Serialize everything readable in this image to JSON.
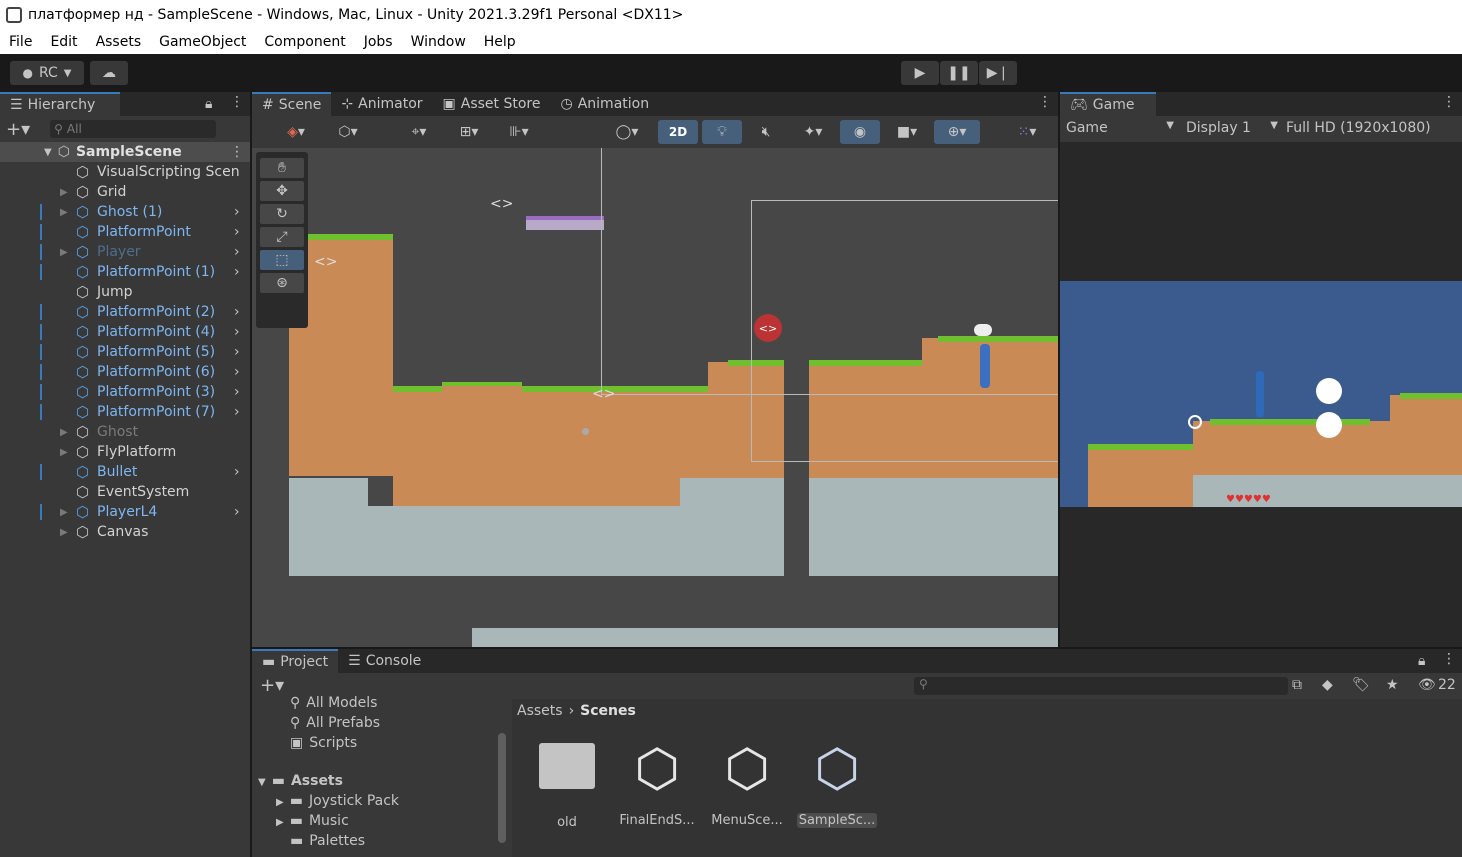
{
  "window": {
    "title": "платформер нд - SampleScene - Windows, Mac, Linux - Unity 2021.3.29f1 Personal <DX11>"
  },
  "menu": [
    "File",
    "Edit",
    "Assets",
    "GameObject",
    "Component",
    "Jobs",
    "Window",
    "Help"
  ],
  "toolbar": {
    "account": "RC"
  },
  "hierarchy": {
    "tab": "Hierarchy",
    "search_placeholder": "All",
    "scene": "SampleScene",
    "items": [
      {
        "label": "VisualScripting Scen",
        "style": "normal",
        "arrow": false,
        "chev": false
      },
      {
        "label": "Grid",
        "style": "normal",
        "arrow": true,
        "chev": false
      },
      {
        "label": "Ghost (1)",
        "style": "blue",
        "arrow": true,
        "chev": true
      },
      {
        "label": "PlatformPoint",
        "style": "blue",
        "arrow": false,
        "chev": true
      },
      {
        "label": "Player",
        "style": "bluedim",
        "arrow": true,
        "chev": true
      },
      {
        "label": "PlatformPoint (1)",
        "style": "blue",
        "arrow": false,
        "chev": true
      },
      {
        "label": "Jump",
        "style": "normal",
        "arrow": false,
        "chev": false
      },
      {
        "label": "PlatformPoint (2)",
        "style": "blue",
        "arrow": false,
        "chev": true
      },
      {
        "label": "PlatformPoint (4)",
        "style": "blue",
        "arrow": false,
        "chev": true
      },
      {
        "label": "PlatformPoint (5)",
        "style": "blue",
        "arrow": false,
        "chev": true
      },
      {
        "label": "PlatformPoint (6)",
        "style": "blue",
        "arrow": false,
        "chev": true
      },
      {
        "label": "PlatformPoint (3)",
        "style": "blue",
        "arrow": false,
        "chev": true
      },
      {
        "label": "PlatformPoint (7)",
        "style": "blue",
        "arrow": false,
        "chev": true
      },
      {
        "label": "Ghost",
        "style": "dim",
        "arrow": true,
        "chev": false
      },
      {
        "label": "FlyPlatform",
        "style": "normal",
        "arrow": true,
        "chev": false
      },
      {
        "label": "Bullet",
        "style": "blue",
        "arrow": false,
        "chev": true
      },
      {
        "label": "EventSystem",
        "style": "normal",
        "arrow": false,
        "chev": false
      },
      {
        "label": "PlayerL4",
        "style": "blue",
        "arrow": true,
        "chev": true
      },
      {
        "label": "Canvas",
        "style": "normal",
        "arrow": true,
        "chev": false
      }
    ]
  },
  "scene_tabs": [
    "Scene",
    "Animator",
    "Asset Store",
    "Animation"
  ],
  "scene_toolbar": {
    "mode_2d": "2D"
  },
  "game": {
    "tab": "Game",
    "mode": "Game",
    "display": "Display 1",
    "resolution": "Full HD (1920x1080)"
  },
  "project": {
    "tabs": [
      "Project",
      "Console"
    ],
    "tree": [
      "All Models",
      "All Prefabs",
      "Scripts"
    ],
    "assets_root": "Assets",
    "folders": [
      "Joystick Pack",
      "Music",
      "Palettes"
    ],
    "breadcrumb": [
      "Assets",
      "Scenes"
    ],
    "hidden_count": "22",
    "assets": [
      {
        "name": "old",
        "type": "folder"
      },
      {
        "name": "FinalEndS...",
        "type": "scene"
      },
      {
        "name": "MenuSce...",
        "type": "scene"
      },
      {
        "name": "SampleSc...",
        "type": "scene",
        "selected": true
      }
    ]
  },
  "colors": {
    "accent": "#3a79bb",
    "panel": "#383838",
    "dark": "#282828",
    "selection": "#2c5d87"
  }
}
